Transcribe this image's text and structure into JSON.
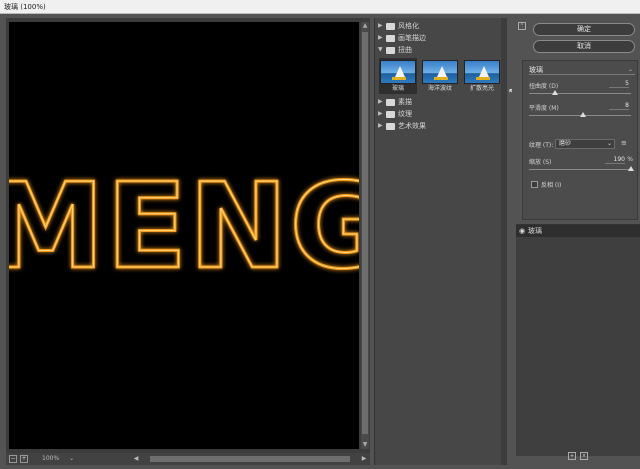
{
  "window": {
    "title": "玻璃 (100%)"
  },
  "preview": {
    "text": "MENG",
    "zoom": "100%"
  },
  "gallery": {
    "categories": [
      {
        "label": "风格化",
        "expanded": false
      },
      {
        "label": "画笔描边",
        "expanded": false
      },
      {
        "label": "扭曲",
        "expanded": true
      },
      {
        "label": "素描",
        "expanded": false
      },
      {
        "label": "纹理",
        "expanded": false
      },
      {
        "label": "艺术效果",
        "expanded": false
      }
    ],
    "thumbnails": [
      {
        "label": "玻璃",
        "selected": true
      },
      {
        "label": "海洋波纹",
        "selected": false
      },
      {
        "label": "扩散亮光",
        "selected": false
      }
    ]
  },
  "buttons": {
    "ok": "确定",
    "cancel": "取消"
  },
  "settings": {
    "filter": "玻璃",
    "distortion": {
      "label": "扭曲度 (D)",
      "value": "5",
      "fraction": 0.25
    },
    "smoothness": {
      "label": "平滑度 (M)",
      "value": "8",
      "fraction": 0.53
    },
    "texture": {
      "label": "纹理 (T):",
      "value": "磨砂"
    },
    "scaling": {
      "label": "缩放 (S)",
      "value": "190",
      "unit": "%",
      "fraction": 1.0
    },
    "invert": {
      "label": "反相 (I)",
      "checked": false
    }
  },
  "layers": {
    "items": [
      {
        "label": "玻璃"
      }
    ]
  },
  "icons": {
    "collapse": "collapse-icon",
    "menu": "panel-menu-icon",
    "new_layer": "new-layer-icon",
    "delete_layer": "trash-icon"
  },
  "colors": {
    "fire": "#f39a1c",
    "canvas": "#000000",
    "panel": "#535353"
  }
}
